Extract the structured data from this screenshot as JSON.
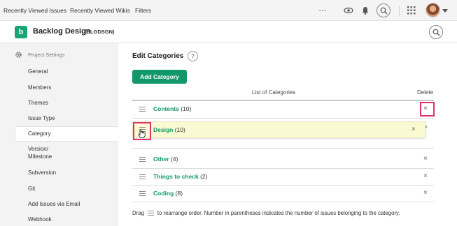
{
  "topbar": {
    "links": [
      "Recently Viewed Issues",
      "Recently Viewed Wikis",
      "Filters"
    ],
    "more_label": "···"
  },
  "project": {
    "logo_letter": "b",
    "name": "Backlog Design",
    "key": "(BLGDSGN)"
  },
  "sidebar": {
    "heading": "Project Settings",
    "items": [
      "General",
      "Members",
      "Themes",
      "Issue Type",
      "Category",
      "Version/\nMilestone",
      "Subversion",
      "Git",
      "Add Issues via Email",
      "Webhook"
    ],
    "active_index": 4
  },
  "main": {
    "title": "Edit Categories",
    "help": "?",
    "add_button": "Add Category",
    "list_header": "List of Categories",
    "delete_header": "Delete",
    "categories": [
      {
        "name": "Contents",
        "count": "(10)"
      },
      {
        "name": "Design",
        "count": "(10)"
      },
      {
        "name": "Other",
        "count": "(4)"
      },
      {
        "name": "Things to check",
        "count": "(2)"
      },
      {
        "name": "Coding",
        "count": "(8)"
      }
    ],
    "delete_glyph": "×",
    "footer_before": "Drag",
    "footer_after": "to rearrange order. Number in parentheses indicates the number of issues belonging to the category."
  },
  "colors": {
    "accent": "#13986b",
    "highlight": "#e0306e",
    "drag_row": "#fafad2"
  },
  "icons": {
    "topbar": [
      "more-icon",
      "eye-icon",
      "bell-icon",
      "search-icon",
      "apps-grid-icon",
      "avatar",
      "caret-down-icon"
    ],
    "sidebar": [
      "gear-icon"
    ],
    "rows": [
      "drag-handle-icon",
      "close-icon",
      "hand-cursor-icon"
    ]
  }
}
